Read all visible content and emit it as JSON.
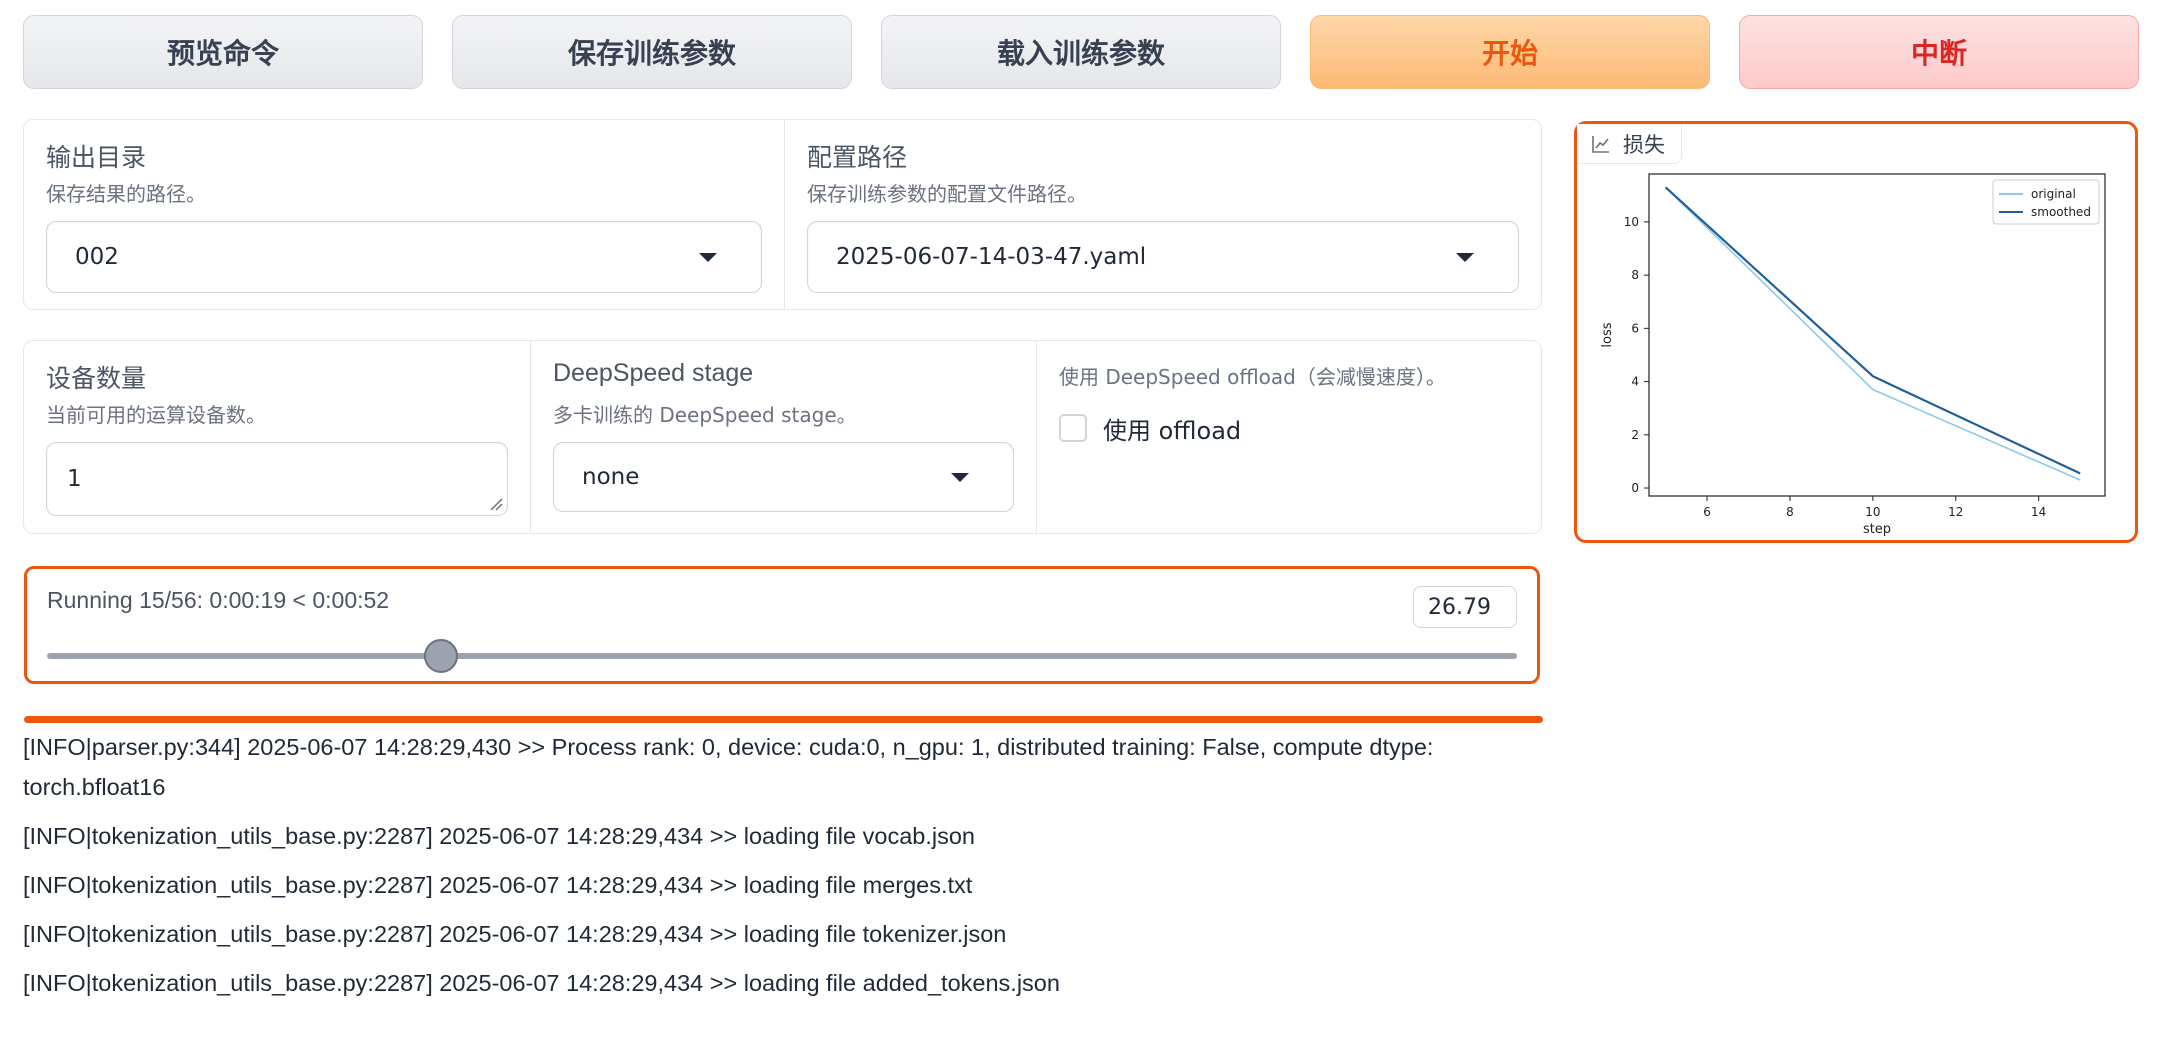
{
  "actions": {
    "preview": "预览命令",
    "save": "保存训练参数",
    "load": "载入训练参数",
    "start": "开始",
    "abort": "中断"
  },
  "output_dir": {
    "label": "输出目录",
    "info": "保存结果的路径。",
    "value": "002"
  },
  "config_path": {
    "label": "配置路径",
    "info": "保存训练参数的配置文件路径。",
    "value": "2025-06-07-14-03-47.yaml"
  },
  "device_count": {
    "label": "设备数量",
    "info": "当前可用的运算设备数。",
    "value": "1"
  },
  "ds_stage": {
    "label": "DeepSpeed stage",
    "info": "多卡训练的 DeepSpeed stage。",
    "value": "none"
  },
  "ds_offload": {
    "info": "使用 DeepSpeed offload（会减慢速度）。",
    "label": "使用 offload",
    "checked": false
  },
  "progress": {
    "text": "Running 15/56: 0:00:19 < 0:00:52",
    "value": "26.79",
    "fraction": 0.2679
  },
  "log_lines": [
    "[INFO|parser.py:344] 2025-06-07 14:28:29,430 >> Process rank: 0, device: cuda:0, n_gpu: 1, distributed training: False, compute dtype: torch.bfloat16",
    "[INFO|tokenization_utils_base.py:2287] 2025-06-07 14:28:29,434 >> loading file vocab.json",
    "[INFO|tokenization_utils_base.py:2287] 2025-06-07 14:28:29,434 >> loading file merges.txt",
    "[INFO|tokenization_utils_base.py:2287] 2025-06-07 14:28:29,434 >> loading file tokenizer.json",
    "[INFO|tokenization_utils_base.py:2287] 2025-06-07 14:28:29,434 >> loading file added_tokens.json"
  ],
  "loss_plot": {
    "tab_label": "损失",
    "icon": "chart-icon"
  },
  "chart_data": {
    "type": "line",
    "xlabel": "step",
    "ylabel": "loss",
    "xlim": [
      4.6,
      15.6
    ],
    "ylim": [
      -0.3,
      11.8
    ],
    "xticks": [
      6,
      8,
      10,
      12,
      14
    ],
    "yticks": [
      0,
      2,
      4,
      6,
      8,
      10
    ],
    "legend_position": "top-right",
    "grid": false,
    "series": [
      {
        "name": "original",
        "color": "#8ecae6",
        "x": [
          5,
          10,
          15
        ],
        "y": [
          11.3,
          3.7,
          0.3
        ]
      },
      {
        "name": "smoothed",
        "color": "#1f5f99",
        "x": [
          5,
          10,
          15
        ],
        "y": [
          11.3,
          4.2,
          0.55
        ]
      }
    ]
  }
}
